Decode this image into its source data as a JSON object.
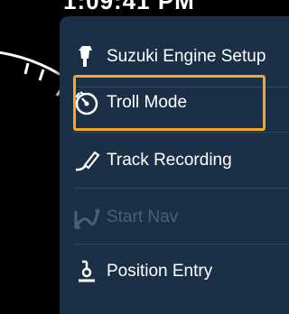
{
  "status_bar": {
    "clock": "1:09:41 PM"
  },
  "menu": {
    "items": [
      {
        "label": "Suzuki Engine Setup",
        "icon": "engine-icon",
        "enabled": true
      },
      {
        "label": "Troll Mode",
        "icon": "troll-speedometer-icon",
        "enabled": true,
        "focused": true
      },
      {
        "label": "Track Recording",
        "icon": "track-pen-icon",
        "enabled": true
      },
      {
        "label": "Start Nav",
        "icon": "route-icon",
        "enabled": false
      },
      {
        "label": "Position Entry",
        "icon": "position-pin-icon",
        "enabled": true
      }
    ]
  },
  "colors": {
    "menu_background": "#1b2f47",
    "focus_border": "#f5a623",
    "disabled_text": "#4a5f78",
    "text": "#ffffff"
  }
}
